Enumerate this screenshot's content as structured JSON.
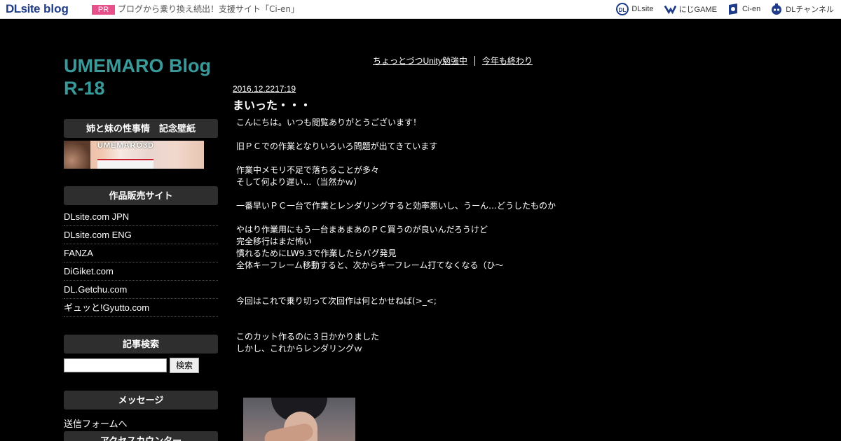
{
  "topbar": {
    "logo_dl": "DLsite",
    "logo_blog": "blog",
    "pr_badge": "PR",
    "pr_text": "ブログから乗り換え続出！支援サイト「Ci-en」",
    "links": [
      {
        "label": "DLsite",
        "icon": "dlsite-icon"
      },
      {
        "label": "にじGAME",
        "icon": "nijigame-icon"
      },
      {
        "label": "Ci-en",
        "icon": "ci-en-icon"
      },
      {
        "label": "DLチャンネル",
        "icon": "dlchannel-icon"
      }
    ]
  },
  "sidebar": {
    "blog_title": "UMEMARO Blog\nR-18",
    "wallpaper_head": "姉と妹の性事情　記念壁紙",
    "banner_text": "UMEMARO3D",
    "sales_head": "作品販売サイト",
    "sales_links": [
      "DLsite.com JPN",
      "DLsite.com ENG",
      "FANZA",
      "DiGiket.com",
      "DL.Getchu.com",
      "ギュッと!Gyutto.com"
    ],
    "search_head": "記事検索",
    "search_button": "検索",
    "message_head": "メッセージ",
    "message_link": "送信フォームへ",
    "counter_head": "アクセスカウンター"
  },
  "pager": {
    "prev": "ちょっとづつUnity勉強中",
    "next": "今年も終わり"
  },
  "post": {
    "date": "2016.12.2217:19",
    "title": "まいった・・・",
    "lines": [
      "こんにちは。いつも閲覧ありがとうございます！",
      "",
      "旧ＰＣでの作業となりいろいろ問題が出てきています",
      "",
      "作業中メモリ不足で落ちることが多々",
      "そして何より遅い…（当然かｗ）",
      "",
      "一番早いＰＣ一台で作業とレンダリングすると効率悪いし、うーん…どうしたものか",
      "",
      "やはり作業用にもう一台まあまあのＰＣ買うのが良いんだろうけど",
      "完全移行はまだ怖い",
      "慣れるためにLW9.3で作業したらバグ発見",
      "全体キーフレーム移動すると、次からキーフレーム打てなくなる（ひ～",
      "",
      "",
      "今回はこれで乗り切って次回作は何とかせねば(>_<;",
      "",
      "",
      "このカット作るのに３日かかりました",
      "しかし、これからレンダリングｗ"
    ]
  }
}
